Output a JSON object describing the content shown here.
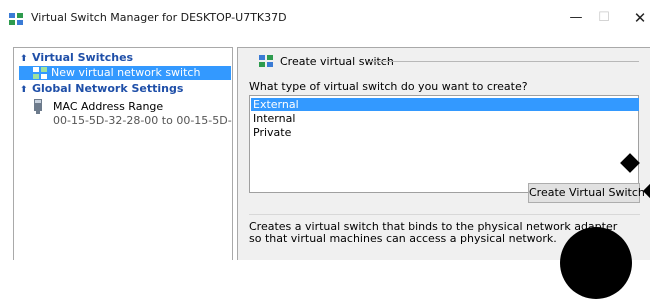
{
  "window": {
    "title": "Virtual Switch Manager for DESKTOP-U7TK37D",
    "controls": {
      "minimize": "—",
      "maximize": "☐",
      "close": "✕"
    }
  },
  "left_pane": {
    "virtual_switches_header": "Virtual Switches",
    "selected_item": "New virtual network switch",
    "global_settings_header": "Global Network Settings",
    "mac_title": "MAC Address Range",
    "mac_value": "00-15-5D-32-28-00 to 00-15-5D-3..."
  },
  "right_pane": {
    "group_title": "Create virtual switch",
    "question": "What type of virtual switch do you want to create?",
    "options": [
      "External",
      "Internal",
      "Private"
    ],
    "selected_option": "External",
    "create_button": "Create Virtual Switch",
    "description": "Creates a virtual switch that binds to the physical network adapter so that virtual machines can access a physical network."
  },
  "colors": {
    "selection": "#3399ff",
    "header_blue": "#1f4fa8",
    "pane_bg": "#f0f0f0"
  },
  "icons": {
    "app": "network-switch-icon",
    "mac": "nic-icon"
  }
}
